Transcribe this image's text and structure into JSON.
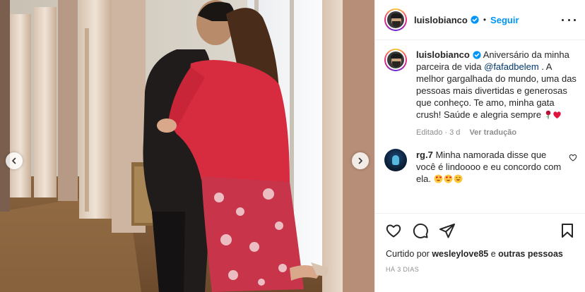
{
  "post": {
    "username": "luislobianco",
    "follow_label": "Seguir",
    "dot": "•"
  },
  "caption": {
    "username": "luislobianco",
    "text_before": "Aniversário da minha parceira de vida ",
    "mention": "@fafadbelem",
    "text_after": " . A melhor gargalhada do mundo, uma das pessoas mais divertidas e generosas que conheço. Te amo, minha gata crush! Saúde e alegria sempre ",
    "edited": "Editado · 3 d",
    "translate_label": "Ver tradução"
  },
  "comment": {
    "username": "rg.7",
    "text": " Minha namorada disse que você é lindoooo e eu concordo com ela. ",
    "avatar_icon": "diver-avatar-icon"
  },
  "likes": {
    "prefix": "Curtido por ",
    "user": "wesleylove85",
    "middle": " e ",
    "others": "outras pessoas"
  },
  "timestamp": "HÁ 3 DIAS",
  "colors": {
    "accent": "#0095f6",
    "text": "#262626",
    "muted": "#8e8e8e",
    "mention": "#00376b",
    "heart": "#ed4956"
  },
  "icons": [
    "chevron-left-icon",
    "chevron-right-icon",
    "verified-badge-icon",
    "more-options-icon",
    "heart-outline-icon",
    "comment-icon",
    "share-icon",
    "bookmark-icon",
    "rose-emoji-icon",
    "red-heart-emoji-icon",
    "heart-eyes-emoji-icon",
    "hug-emoji-icon"
  ]
}
